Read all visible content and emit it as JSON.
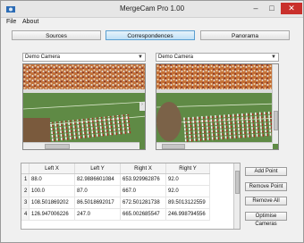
{
  "window": {
    "title": "MergeCam Pro 1.00",
    "minimize": "–",
    "maximize": "□",
    "close": "✕"
  },
  "menu": [
    {
      "label": "File"
    },
    {
      "label": "About"
    }
  ],
  "tabs": [
    {
      "label": "Sources",
      "active": false
    },
    {
      "label": "Correspondences",
      "active": true
    },
    {
      "label": "Panorama",
      "active": false
    }
  ],
  "left_camera": {
    "selected": "Demo Camera"
  },
  "right_camera": {
    "selected": "Demo Camera"
  },
  "table": {
    "columns": [
      "",
      "Left X",
      "Left Y",
      "Right X",
      "Right Y"
    ],
    "rows": [
      [
        "1",
        "88.0",
        "82.9886601084",
        "653.929962876",
        "92.0"
      ],
      [
        "2",
        "100.0",
        "87.0",
        "667.0",
        "92.0"
      ],
      [
        "3",
        "108.501869202",
        "86.5018692017",
        "672.501281738",
        "89.5013122559"
      ],
      [
        "4",
        "126.947006226",
        "247.0",
        "665.002685547",
        "246.998794556"
      ]
    ]
  },
  "actions": [
    {
      "label": "Add Point"
    },
    {
      "label": "Remove Point"
    },
    {
      "label": "Remove All"
    },
    {
      "label": "Optimise Cameras"
    }
  ],
  "colors": {
    "active_tab": "#bfe0f6",
    "close_button": "#c9302c"
  }
}
